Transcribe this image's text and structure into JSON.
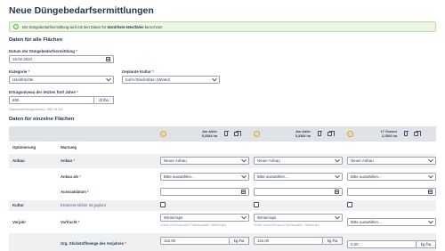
{
  "page": {
    "title": "Neue Düngebedarfsermittlungen",
    "info_prefix": "Die Düngebedarfsermittlung wird mit den Daten für",
    "info_region": "Nordrhein-Westfalen",
    "info_suffix": "berechnet!"
  },
  "general": {
    "section_title": "Daten für alle Flächen",
    "date_label": "Datum der Düngebedarfsermittlung",
    "date_value": "16.02.2023",
    "category_label": "Kategorie",
    "category_value": "Hackfrüchte",
    "crop_label": "Geplante Kultur",
    "crop_value": "Kohl-/Steckrüben (Winter)",
    "yield_label": "Ertragsniveau der letzten fünf Jahre",
    "yield_value": "650",
    "yield_unit": "dt /ha",
    "yield_hint": "Standardertragsniveau: 650 dt /ha",
    "required_mark": "*"
  },
  "fields_section": {
    "title": "Daten für einzelne Flächen",
    "columns": [
      {
        "name": "Am Adler",
        "size": "5,3384 ha"
      },
      {
        "name": "Am Adler",
        "size": "5,3384 ha"
      },
      {
        "name": "17 Grasen",
        "size": "2,1500 ha"
      }
    ]
  },
  "rows": {
    "optimierung": {
      "group": "Optimierung",
      "label": "Warnung"
    },
    "anbau": {
      "group": "Anbau",
      "label": "Anbau",
      "values": [
        "Neuer Anbau",
        "Neuer Anbau",
        "Neuer Anbau"
      ]
    },
    "anbau_als": {
      "label": "Anbau als",
      "values": [
        "Bitte auswählen...",
        "Bitte auswählen...",
        "Bitte auswählen..."
      ]
    },
    "aussaat": {
      "label": "Aussaatdatum"
    },
    "kultur": {
      "group": "Kultur",
      "label": "Ernterest-Abfuhr ist geplant"
    },
    "vorjahr": {
      "group": "Vorjahr",
      "label": "Vorfrucht",
      "values": [
        "Winterraps",
        "Winterraps",
        "Bitte auswählen..."
      ],
      "hint": "Letzte Vorfrucht nach Flächendaten: Winterraps"
    },
    "n_menge": {
      "label": "Org. Stickstoffmenge des Vorjahres",
      "values": [
        "116,00",
        "116,00",
        "0,00"
      ],
      "unit": "kg /ha"
    }
  },
  "colors": {
    "accent": "#e0a020",
    "success": "#4caf50",
    "header_bg": "#dfe3e7"
  },
  "icons": [
    "check-circle-icon",
    "calendar-icon",
    "chevron-down-icon",
    "trash-icon",
    "copy-icon"
  ]
}
